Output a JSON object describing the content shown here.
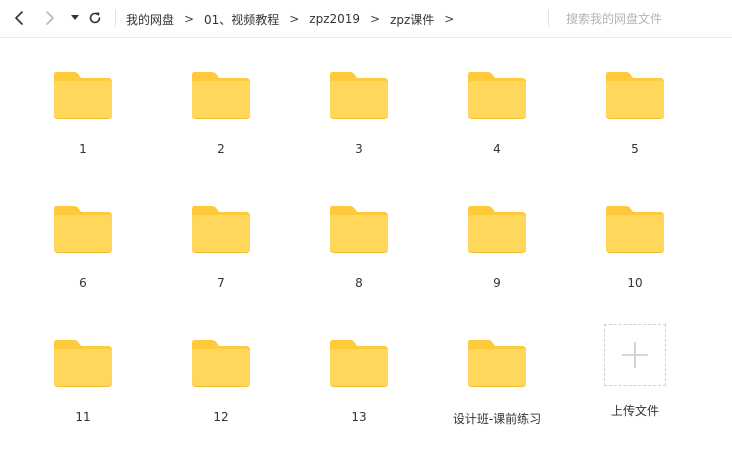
{
  "toolbar": {
    "back_icon": "chevron-left-icon",
    "forward_icon": "chevron-right-icon",
    "history_icon": "caret-down-icon",
    "refresh_icon": "refresh-icon",
    "breadcrumb": [
      "我的网盘",
      "01、视频教程",
      "zpz2019",
      "zpz课件"
    ],
    "separator": ">",
    "search_placeholder": "搜索我的网盘文件"
  },
  "items": [
    {
      "type": "folder",
      "name": "1"
    },
    {
      "type": "folder",
      "name": "2"
    },
    {
      "type": "folder",
      "name": "3"
    },
    {
      "type": "folder",
      "name": "4"
    },
    {
      "type": "folder",
      "name": "5"
    },
    {
      "type": "folder",
      "name": "6"
    },
    {
      "type": "folder",
      "name": "7"
    },
    {
      "type": "folder",
      "name": "8"
    },
    {
      "type": "folder",
      "name": "9"
    },
    {
      "type": "folder",
      "name": "10"
    },
    {
      "type": "folder",
      "name": "11"
    },
    {
      "type": "folder",
      "name": "12"
    },
    {
      "type": "folder",
      "name": "13"
    },
    {
      "type": "folder",
      "name": "设计班-课前练习"
    }
  ],
  "upload": {
    "label": "上传文件",
    "icon": "plus-icon"
  },
  "colors": {
    "folder_front": "#FFD75A",
    "folder_back": "#FFC93C",
    "folder_shadow": "#F5BE35",
    "divider": "#ECECEC",
    "placeholder": "#B3B3B3"
  }
}
